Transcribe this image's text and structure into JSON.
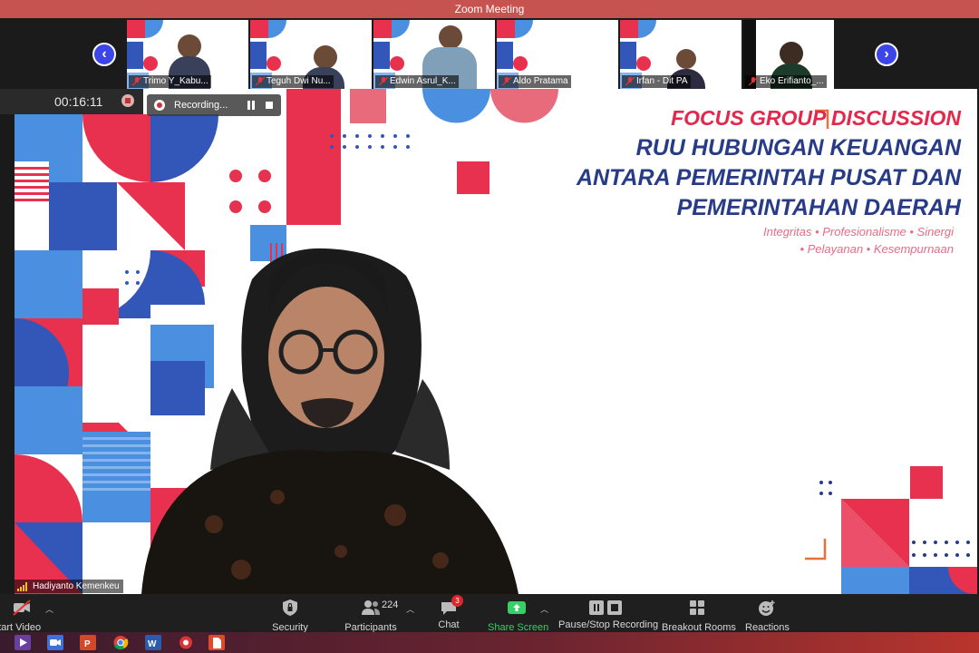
{
  "window": {
    "title": "Zoom Meeting"
  },
  "participants_strip": [
    {
      "name": "Trimo Y_Kabu..."
    },
    {
      "name": "Teguh Dwi Nu..."
    },
    {
      "name": "Edwin Asrul_K..."
    },
    {
      "name": "Aldo Pratama"
    },
    {
      "name": "Irfan - Dit PA"
    },
    {
      "name": "Eko Erifianto_..."
    }
  ],
  "recording": {
    "elapsed": "00:16:11",
    "status_label": "Recording..."
  },
  "slide": {
    "title_line1": "FOCUS GROUP DISCUSSION",
    "title_line2": "RUU HUBUNGAN KEUANGAN",
    "title_line3": "ANTARA PEMERINTAH PUSAT DAN",
    "title_line4": "PEMERINTAHAN DAERAH",
    "tagline_line1": "Integritas • Profesionalisme • Sinergi",
    "tagline_line2": "• Pelayanan • Kesempurnaan"
  },
  "active_speaker": {
    "name": "Hadiyanto Kemenkeu"
  },
  "toolbar": {
    "start_video": "Start Video",
    "security": "Security",
    "participants": "Participants",
    "participants_count": "224",
    "chat": "Chat",
    "chat_badge": "3",
    "share_screen": "Share Screen",
    "pause_stop_recording": "Pause/Stop Recording",
    "breakout_rooms": "Breakout Rooms",
    "reactions": "Reactions"
  },
  "colors": {
    "titlebar": "#c6534f",
    "accent_red": "#e3284b",
    "accent_navy": "#273b87",
    "share_green": "#36d065"
  },
  "icons": [
    "chevron-left-icon",
    "chevron-right-icon",
    "video-off-icon",
    "shield-icon",
    "people-icon",
    "chat-icon",
    "share-up-icon",
    "pause-icon",
    "stop-icon",
    "grid-icon",
    "smile-icon"
  ]
}
